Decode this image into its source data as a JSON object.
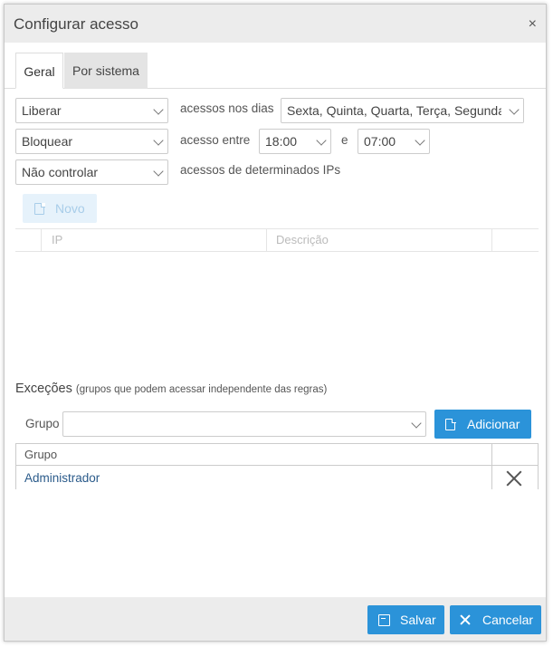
{
  "dialog": {
    "title": "Configurar acesso",
    "close": "×"
  },
  "tabs": [
    {
      "label": "Geral",
      "active": true
    },
    {
      "label": "Por sistema",
      "active": false
    }
  ],
  "rules": {
    "row1": {
      "action": "Liberar",
      "text": "acessos nos dias",
      "days": "Sexta, Quinta, Quarta, Terça, Segunda"
    },
    "row2": {
      "action": "Bloquear",
      "text": "acesso entre",
      "from": "18:00",
      "and": "e",
      "to": "07:00"
    },
    "row3": {
      "action": "Não controlar",
      "text": "acessos de determinados IPs"
    }
  },
  "ip_grid": {
    "new_button": "Novo",
    "columns": [
      "IP",
      "Descrição"
    ]
  },
  "exceptions": {
    "title": "Exceções",
    "subtitle": "(grupos que podem acessar independente das regras)",
    "group_label": "Grupo",
    "group_value": "",
    "add_button": "Adicionar",
    "table_header": "Grupo",
    "rows": [
      {
        "name": "Administrador"
      }
    ]
  },
  "footer": {
    "save": "Salvar",
    "cancel": "Cancelar"
  },
  "colors": {
    "primary": "#2b93d9",
    "disabled": "#e6f2fb",
    "titlebar": "#ececec"
  }
}
